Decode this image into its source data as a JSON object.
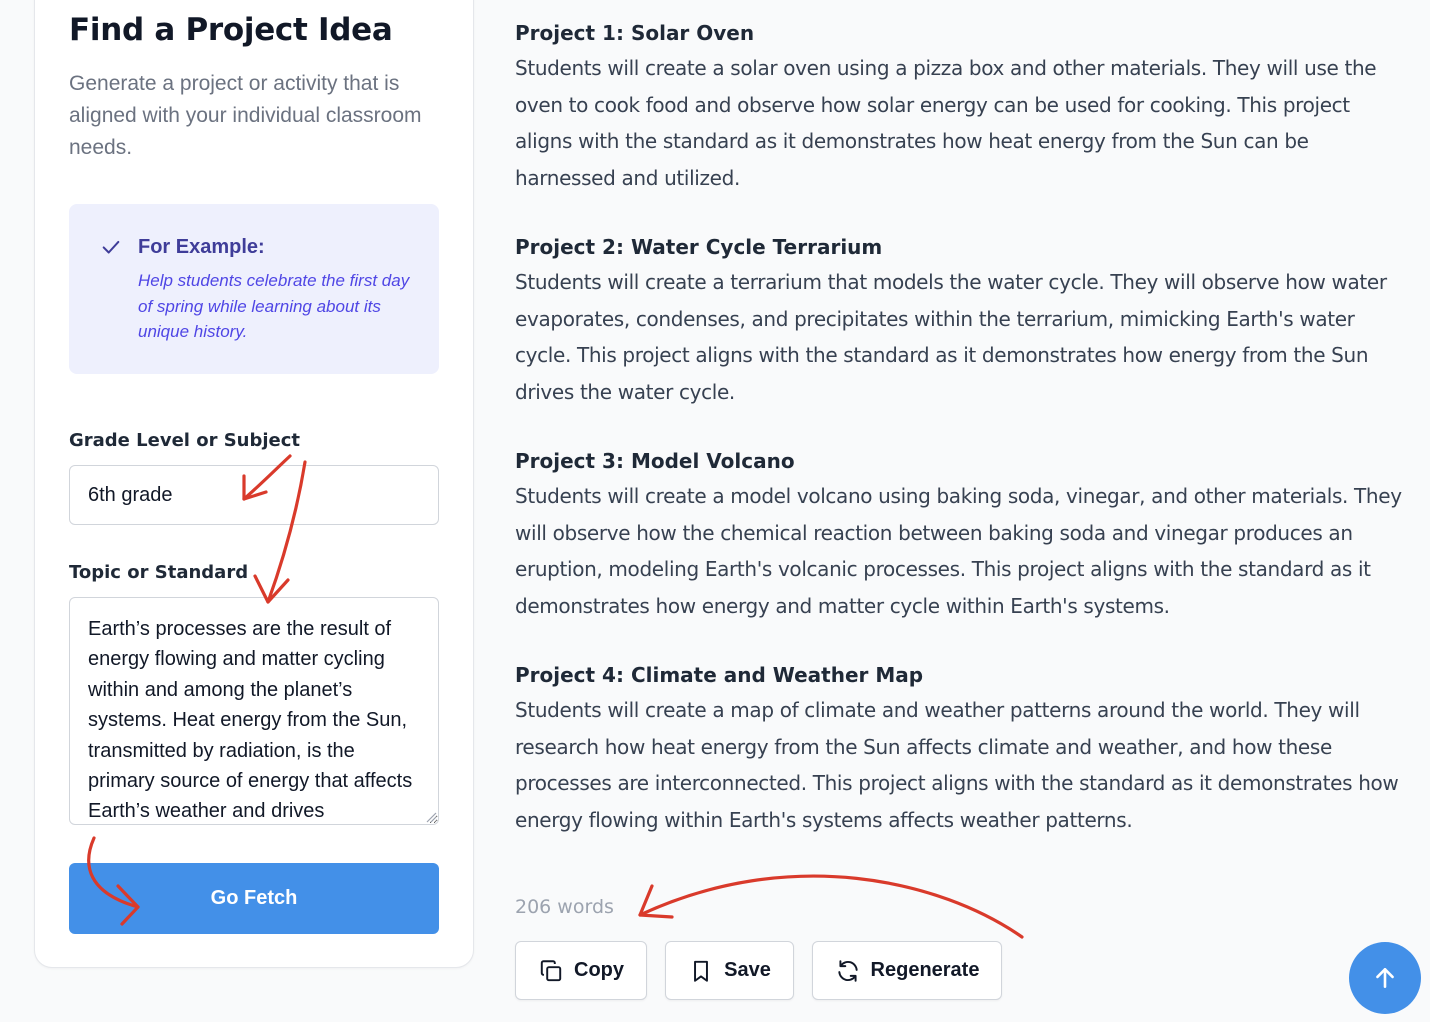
{
  "sidebar": {
    "title": "Find a Project Idea",
    "subtitle": "Generate a project or activity that is aligned with your individual classroom needs.",
    "example": {
      "title": "For Example:",
      "text": "Help students celebrate the first day of spring while learning about its unique history."
    },
    "grade_label": "Grade Level or Subject",
    "grade_value": "6th grade",
    "topic_label": "Topic or Standard",
    "topic_value": "Earth’s processes are the result of energy flowing and matter cycling within and among the planet’s systems. Heat energy from the Sun, transmitted by radiation, is the primary source of energy that affects Earth’s weather and drives",
    "submit_label": "Go Fetch"
  },
  "results": {
    "projects": [
      {
        "title": "Project 1: Solar Oven",
        "description": "Students will create a solar oven using a pizza box and other materials. They will use the oven to cook food and observe how solar energy can be used for cooking. This project aligns with the standard as it demonstrates how heat energy from the Sun can be harnessed and utilized."
      },
      {
        "title": "Project 2: Water Cycle Terrarium",
        "description": "Students will create a terrarium that models the water cycle. They will observe how water evaporates, condenses, and precipitates within the terrarium, mimicking Earth's water cycle. This project aligns with the standard as it demonstrates how energy from the Sun drives the water cycle."
      },
      {
        "title": "Project 3: Model Volcano",
        "description": "Students will create a model volcano using baking soda, vinegar, and other materials. They will observe how the chemical reaction between baking soda and vinegar produces an eruption, modeling Earth's volcanic processes. This project aligns with the standard as it demonstrates how energy and matter cycle within Earth's systems."
      },
      {
        "title": "Project 4: Climate and Weather Map",
        "description": "Students will create a map of climate and weather patterns around the world. They will research how heat energy from the Sun affects climate and weather, and how these processes are interconnected. This project aligns with the standard as it demonstrates how energy flowing within Earth's systems affects weather patterns."
      }
    ],
    "word_count": "206 words",
    "actions": {
      "copy_label": "Copy",
      "save_label": "Save",
      "regenerate_label": "Regenerate"
    }
  },
  "colors": {
    "primary": "#4390e8",
    "example_bg": "#eef0fd",
    "example_title": "#3f3d99",
    "example_text": "#4f46e5",
    "annotation": "#d93a2b"
  },
  "icons": {
    "check": "check-icon",
    "copy": "copy-icon",
    "save": "bookmark-icon",
    "regenerate": "refresh-icon",
    "scroll_top": "arrow-up-icon"
  }
}
